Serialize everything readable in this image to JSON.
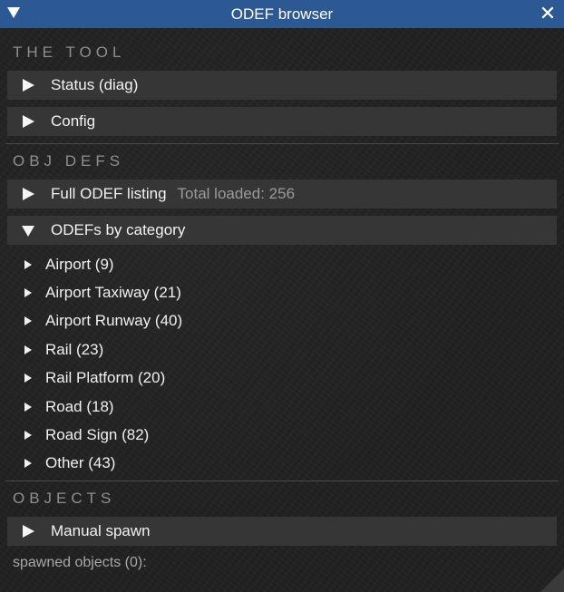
{
  "window": {
    "title": "ODEF browser",
    "accent_color": "#2c5993",
    "collapse_icon": "triangle-down",
    "close_icon": "close-x"
  },
  "sections": {
    "tool": {
      "label": "THE TOOL",
      "headers": [
        {
          "label": "Status (diag)",
          "expanded": false
        },
        {
          "label": "Config",
          "expanded": false
        }
      ]
    },
    "obj_defs": {
      "label": "OBJ DEFS",
      "full_listing": {
        "label": "Full ODEF listing",
        "extra": "Total loaded: 256",
        "expanded": false
      },
      "by_category": {
        "label": "ODEFs by category",
        "expanded": true
      },
      "categories": [
        {
          "label": "Airport (9)"
        },
        {
          "label": "Airport Taxiway (21)"
        },
        {
          "label": "Airport Runway (40)"
        },
        {
          "label": "Rail (23)"
        },
        {
          "label": "Rail Platform (20)"
        },
        {
          "label": "Road (18)"
        },
        {
          "label": "Road Sign (82)"
        },
        {
          "label": "Other (43)"
        }
      ]
    },
    "objects": {
      "label": "OBJECTS",
      "manual_spawn": {
        "label": "Manual spawn",
        "expanded": false
      },
      "spawned_text": "spawned objects (0):"
    }
  }
}
